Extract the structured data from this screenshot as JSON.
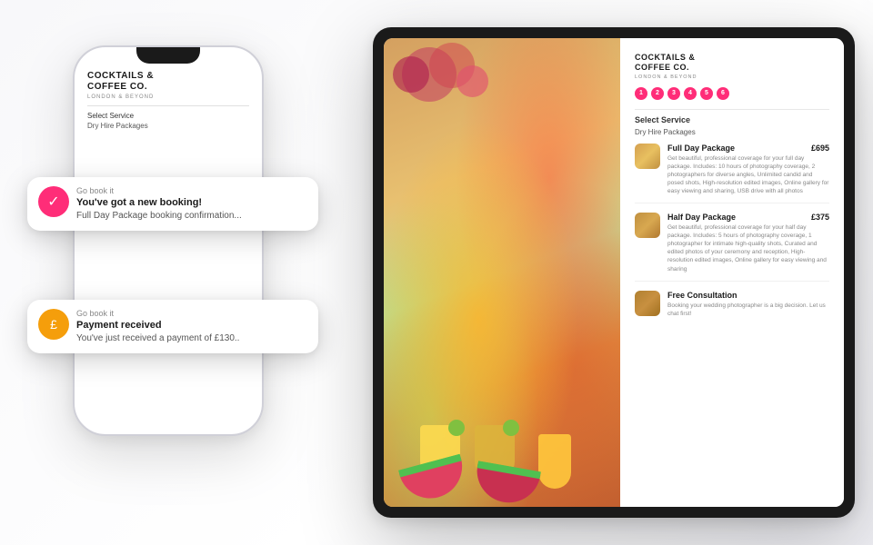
{
  "background": {
    "color": "#f8f8fa"
  },
  "phone": {
    "brand_line1": "COCKTAILS &",
    "brand_line2": "COFFEE CO.",
    "subtitle": "LONDON & BEYOND",
    "select_service_label": "Select Service",
    "dry_hire_label": "Dry Hire Packages"
  },
  "notifications": {
    "top": {
      "app_name": "Go book it",
      "title": "You've got a new booking!",
      "body": "Full Day Package booking confirmation..."
    },
    "bottom": {
      "app_name": "Go book it",
      "title": "Payment received",
      "body": "You've just received a payment of £130.."
    }
  },
  "tablet": {
    "brand_line1": "COCKTAILS &",
    "brand_line2": "COFFEE CO.",
    "subtitle": "LONDON & BEYOND",
    "select_service_label": "Select Service",
    "dry_hire_label": "Dry Hire Packages",
    "step_dots": [
      "1",
      "2",
      "3",
      "4",
      "5",
      "6"
    ],
    "services": [
      {
        "name": "Full Day Package",
        "price": "£695",
        "description": "Get beautiful, professional coverage for your full day package. Includes: 10 hours of photography coverage, 2 photographers for diverse angles, Unlimited candid and posed shots, High-resolution edited images, Online gallery for easy viewing and sharing, USB drive with all photos"
      },
      {
        "name": "Half Day Package",
        "price": "£375",
        "description": "Get beautiful, professional coverage for your half day package. Includes: 5 hours of photography coverage, 1 photographer for intimate high-quality shots, Curated and edited photos of your ceremony and reception, High-resolution edited images, Online gallery for easy viewing and sharing"
      },
      {
        "name": "Free Consultation",
        "price": "",
        "description": "Booking your wedding photographer is a big decision. Let us chat first!"
      }
    ]
  },
  "icons": {
    "check": "✓",
    "pound": "£"
  }
}
